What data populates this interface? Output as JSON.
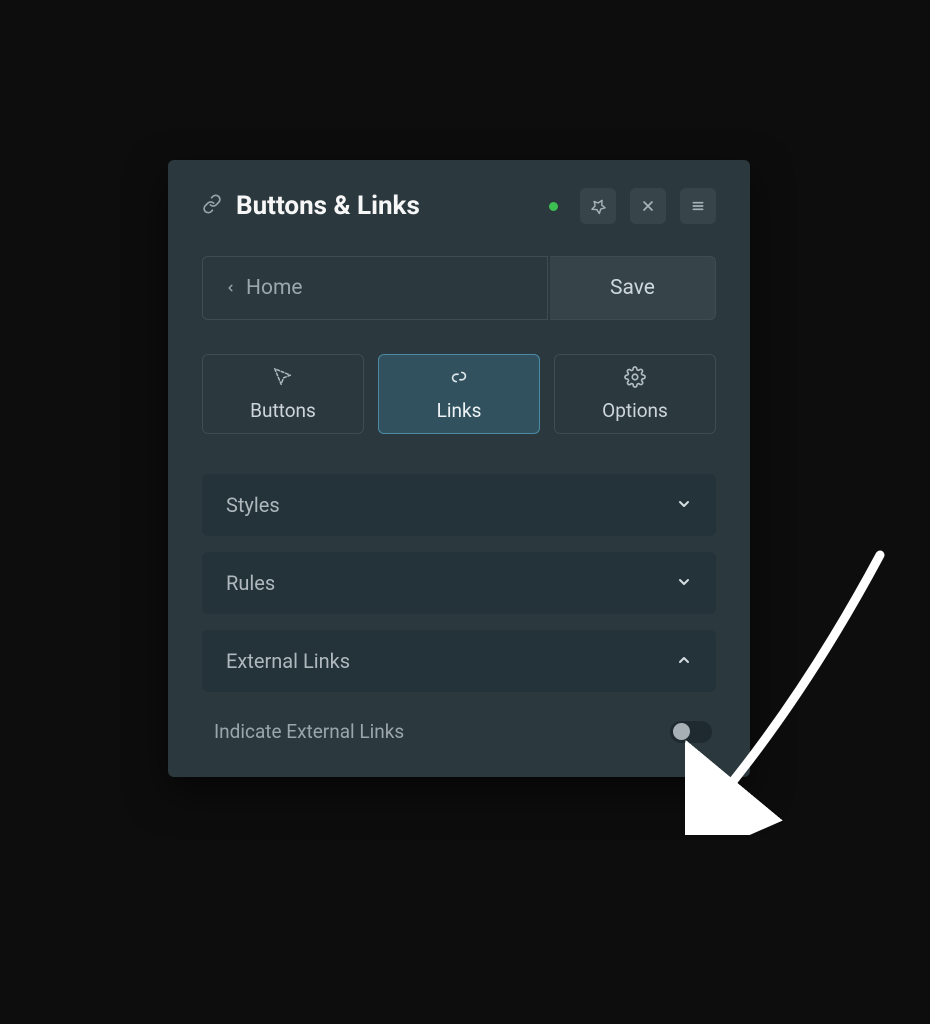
{
  "header": {
    "title": "Buttons & Links"
  },
  "toolbar": {
    "home_label": "Home",
    "save_label": "Save"
  },
  "tabs": {
    "buttons": "Buttons",
    "links": "Links",
    "options": "Options"
  },
  "accordions": {
    "styles": "Styles",
    "rules": "Rules",
    "external_links": "External Links"
  },
  "settings": {
    "indicate_external": "Indicate External Links"
  }
}
